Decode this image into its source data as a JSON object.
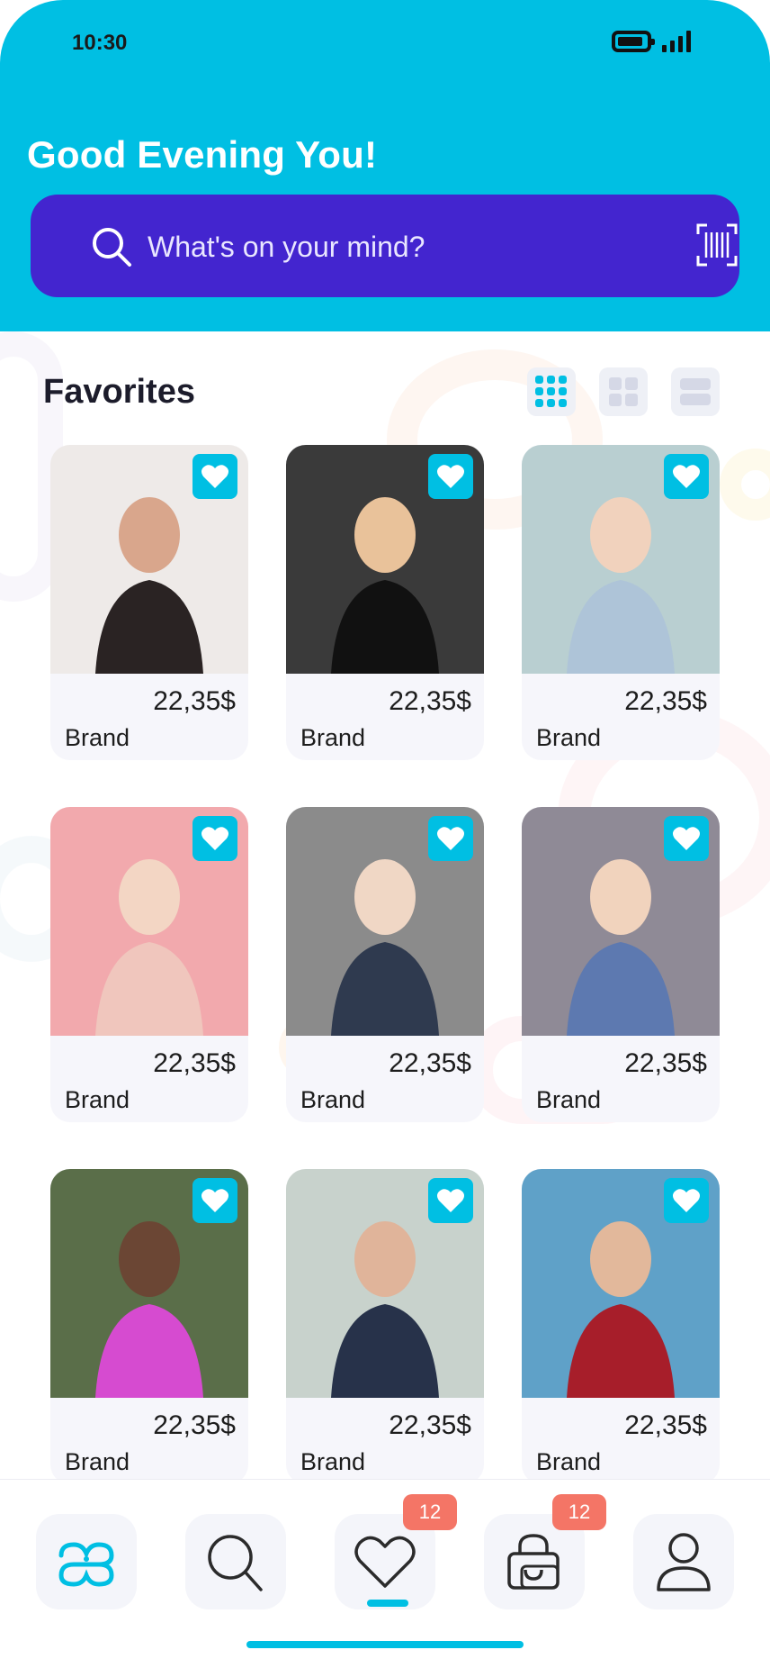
{
  "status_bar": {
    "time": "10:30"
  },
  "header": {
    "greeting": "Good Evening You!",
    "search": {
      "placeholder": "What's on your mind?"
    }
  },
  "favorites": {
    "title": "Favorites",
    "view_modes": [
      "grid-3-icon",
      "grid-2-icon",
      "list-icon"
    ],
    "active_view": "grid-3-icon",
    "items": [
      {
        "price": "22,35$",
        "brand": "Brand",
        "favorited": true
      },
      {
        "price": "22,35$",
        "brand": "Brand",
        "favorited": true
      },
      {
        "price": "22,35$",
        "brand": "Brand",
        "favorited": true
      },
      {
        "price": "22,35$",
        "brand": "Brand",
        "favorited": true
      },
      {
        "price": "22,35$",
        "brand": "Brand",
        "favorited": true
      },
      {
        "price": "22,35$",
        "brand": "Brand",
        "favorited": true
      },
      {
        "price": "22,35$",
        "brand": "Brand",
        "favorited": true
      },
      {
        "price": "22,35$",
        "brand": "Brand",
        "favorited": true
      },
      {
        "price": "22,35$",
        "brand": "Brand",
        "favorited": true
      }
    ]
  },
  "bottom_nav": {
    "items": [
      {
        "icon": "home-logo-icon",
        "badge": ""
      },
      {
        "icon": "search-icon",
        "badge": ""
      },
      {
        "icon": "heart-icon",
        "badge": "12",
        "active": true
      },
      {
        "icon": "shopping-bag-icon",
        "badge": "12"
      },
      {
        "icon": "profile-icon",
        "badge": ""
      }
    ]
  },
  "colors": {
    "accent": "#00BFE3",
    "search_bar": "#4325CF",
    "badge": "#F47566",
    "card_bg": "#F6F6FB"
  }
}
